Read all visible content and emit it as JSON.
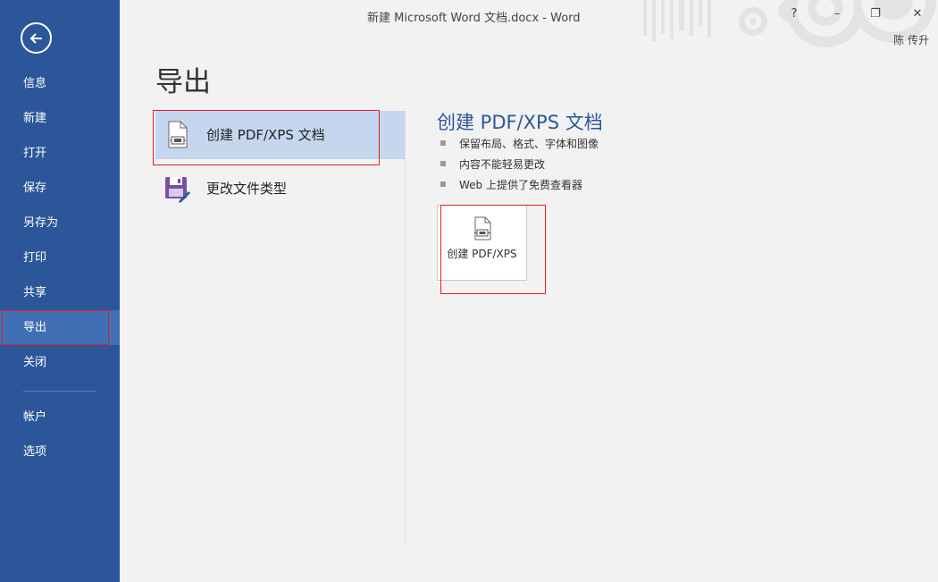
{
  "window": {
    "title": "新建 Microsoft Word 文档.docx - Word",
    "help_label": "?",
    "minimize_label": "–",
    "restore_label": "❐",
    "close_label": "✕",
    "user": "陈 传升"
  },
  "sidebar": {
    "back_icon": "back-arrow-icon",
    "items": [
      {
        "label": "信息"
      },
      {
        "label": "新建"
      },
      {
        "label": "打开"
      },
      {
        "label": "保存"
      },
      {
        "label": "另存为"
      },
      {
        "label": "打印"
      },
      {
        "label": "共享"
      },
      {
        "label": "导出",
        "active": true
      },
      {
        "label": "关闭"
      }
    ],
    "footer_items": [
      {
        "label": "帐户"
      },
      {
        "label": "选项"
      }
    ]
  },
  "main": {
    "title": "导出",
    "options": [
      {
        "label": "创建 PDF/XPS 文档",
        "icon": "pdf-document-icon",
        "selected": true
      },
      {
        "label": "更改文件类型",
        "icon": "save-as-file-type-icon"
      }
    ],
    "detail": {
      "title": "创建 PDF/XPS 文档",
      "bullets": [
        "保留布局、格式、字体和图像",
        "内容不能轻易更改",
        "Web 上提供了免费查看器"
      ],
      "button_label": "创建 PDF/XPS"
    }
  },
  "colors": {
    "sidebar": "#2b579a",
    "sidebar_active": "#3f6fb4",
    "selected_option": "#c5d7ef",
    "accent_title": "#2b579a",
    "annotation_red": "#e02020"
  }
}
